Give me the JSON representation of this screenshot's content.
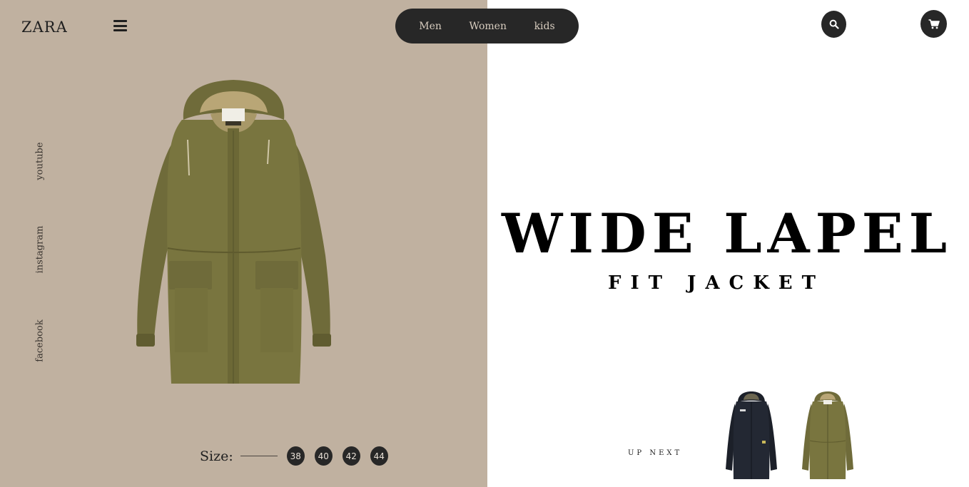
{
  "brand": {
    "logo": "ZARA"
  },
  "categories": [
    "Men",
    "Women",
    "kids"
  ],
  "social": [
    "youtube",
    "instagram",
    "facebook"
  ],
  "product": {
    "title": "WIDE LAPEL",
    "subtitle": "FIT JACKET",
    "size_label": "Size:",
    "sizes": [
      "38",
      "40",
      "42",
      "44"
    ],
    "color": "#74703f"
  },
  "up_next": {
    "label": "UP NEXT",
    "items": [
      {
        "color": "#1f2430",
        "icon": "black-parka-thumbnail"
      },
      {
        "color": "#74703f",
        "icon": "olive-parka-thumbnail"
      }
    ]
  },
  "colors": {
    "left_bg": "#c0b1a0",
    "dark": "#272727",
    "pill_text": "#d8cdbf"
  },
  "icons": {
    "menu": "hamburger-icon",
    "search": "search-icon",
    "cart": "cart-icon"
  }
}
